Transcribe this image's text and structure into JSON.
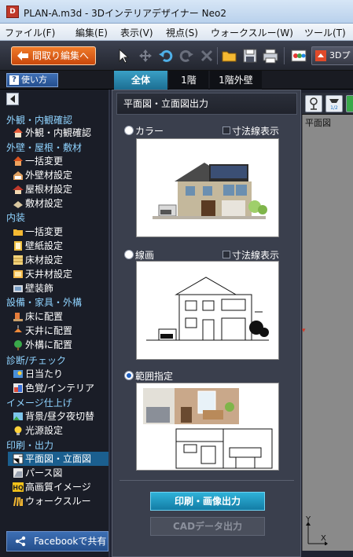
{
  "window": {
    "app_icon_label": "D",
    "title": "PLAN-A.m3d - 3Dインテリアデザイナー Neo2"
  },
  "menu": [
    "ファイル(F)",
    "編集(E)",
    "表示(V)",
    "視点(S)",
    "ウォークスルー(W)",
    "ツール(T)"
  ],
  "toolbar": {
    "back_label": "間取り編集へ",
    "view_3d_label": "3Dプ",
    "icons": [
      "cursor-icon",
      "pan-icon",
      "undo-icon",
      "redo-icon",
      "delete-icon",
      "open-folder-icon",
      "save-icon",
      "print-icon",
      "color-palette-icon",
      "3d-view-icon"
    ]
  },
  "tabs_row": {
    "help_icon": "?",
    "help_label": "使い方",
    "tabs": [
      {
        "label": "全体",
        "active": true
      },
      {
        "label": "1階",
        "active": false
      },
      {
        "label": "1階外壁",
        "active": false
      }
    ]
  },
  "sidebar": {
    "sections": [
      {
        "header": "外観・内観確認",
        "items": [
          {
            "label": "外観・内観確認",
            "icon": "house-icon"
          }
        ]
      },
      {
        "header": "外壁・屋根・敷材",
        "items": [
          {
            "label": "一括変更",
            "icon": "house-paint-icon"
          },
          {
            "label": "外壁材設定",
            "icon": "wall-icon"
          },
          {
            "label": "屋根材設定",
            "icon": "roof-icon"
          },
          {
            "label": "敷材設定",
            "icon": "ground-icon"
          }
        ]
      },
      {
        "header": "内装",
        "items": [
          {
            "label": "一括変更",
            "icon": "folder-icon"
          },
          {
            "label": "壁紙設定",
            "icon": "wallpaper-icon"
          },
          {
            "label": "床材設定",
            "icon": "floor-icon"
          },
          {
            "label": "天井材設定",
            "icon": "ceiling-icon"
          },
          {
            "label": "壁装飾",
            "icon": "wall-decor-icon"
          }
        ]
      },
      {
        "header": "設備・家具・外構",
        "items": [
          {
            "label": "床に配置",
            "icon": "floor-place-icon"
          },
          {
            "label": "天井に配置",
            "icon": "ceiling-light-icon"
          },
          {
            "label": "外構に配置",
            "icon": "tree-icon"
          }
        ]
      },
      {
        "header": "診断/チェック",
        "items": [
          {
            "label": "日当たり",
            "icon": "sunlight-icon"
          },
          {
            "label": "色覚/インテリア",
            "icon": "color-vision-icon"
          }
        ]
      },
      {
        "header": "イメージ仕上げ",
        "items": [
          {
            "label": "背景/昼夕夜切替",
            "icon": "background-icon"
          },
          {
            "label": "光源設定",
            "icon": "light-bulb-icon"
          }
        ]
      },
      {
        "header": "印刷・出力",
        "items": [
          {
            "label": "平面図・立面図",
            "icon": "floor-plan-icon",
            "selected": true
          },
          {
            "label": "パース図",
            "icon": "perspective-icon"
          },
          {
            "label": "高画質イメージ",
            "icon": "hq-image-icon"
          },
          {
            "label": "ウォークスルー",
            "icon": "walkthrough-icon"
          }
        ]
      }
    ],
    "facebook_label": "Facebookで共有"
  },
  "panel": {
    "title": "平面図・立面図出力",
    "options": [
      {
        "label": "カラー",
        "checked": false,
        "dim_checkbox": "寸法線表示"
      },
      {
        "label": "線画",
        "checked": false,
        "dim_checkbox": "寸法線表示"
      },
      {
        "label": "範囲指定",
        "checked": true,
        "dim_checkbox": ""
      }
    ],
    "print_button": "印刷・画像出力",
    "cad_button": "CADデータ出力"
  },
  "viewport": {
    "label": "平面図",
    "axis_y": "Y",
    "axis_x": "X",
    "marker": "▾",
    "toolbar_icons": [
      "light-icon",
      "level-icon"
    ],
    "level_badge": "1/2"
  }
}
